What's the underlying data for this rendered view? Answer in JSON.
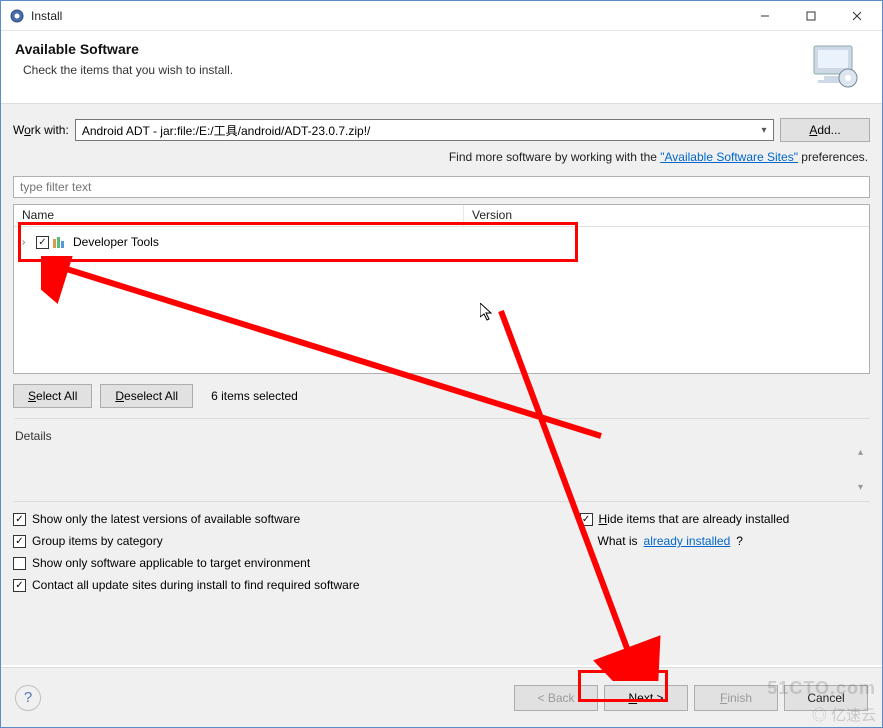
{
  "window": {
    "title": "Install"
  },
  "header": {
    "title": "Available Software",
    "subtitle": "Check the items that you wish to install."
  },
  "work_with": {
    "label_pre": "W",
    "label_u": "o",
    "label_post": "rk with:",
    "value": "Android ADT - jar:file:/E:/工具/android/ADT-23.0.7.zip!/",
    "add_label": "Add..."
  },
  "findmore": {
    "prefix": "Find more software by working with the ",
    "link": "\"Available Software Sites\"",
    "suffix": " preferences."
  },
  "filter_placeholder": "type filter text",
  "tree": {
    "columns": {
      "name": "Name",
      "version": "Version"
    },
    "item": {
      "label": "Developer Tools"
    }
  },
  "selection": {
    "select_all": "Select All",
    "deselect_all": "Deselect All",
    "count_text": "6 items selected"
  },
  "details_label": "Details",
  "options": {
    "left": [
      {
        "checked": true,
        "label": "Show only the latest versions of available software"
      },
      {
        "checked": true,
        "label": "Group items by category"
      },
      {
        "checked": false,
        "label": "Show only software applicable to target environment"
      },
      {
        "checked": true,
        "label": "Contact all update sites during install to find required software"
      }
    ],
    "right": {
      "hide": {
        "checked": true,
        "label": "Hide items that are already installed"
      },
      "whatis_pre": "What is ",
      "whatis_link": "already installed",
      "whatis_post": "?"
    }
  },
  "footer": {
    "back": "< Back",
    "next": "Next >",
    "finish": "Finish",
    "cancel": "Cancel"
  },
  "watermark1": "51CTO.com",
  "watermark2": "◎ 亿速云"
}
